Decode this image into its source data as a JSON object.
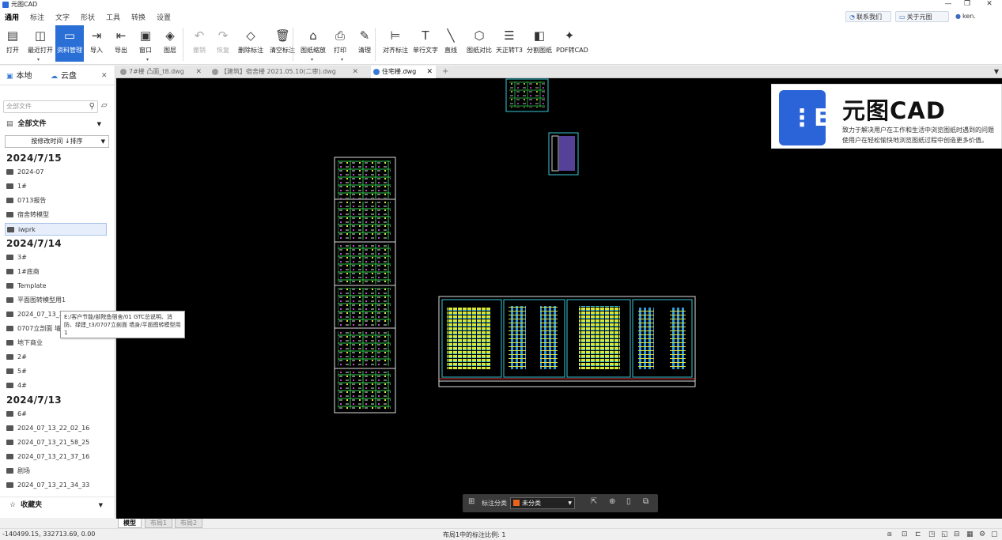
{
  "window": {
    "title": "元图CAD",
    "minimize": "—",
    "restore": "❐",
    "close": "✕"
  },
  "menu": [
    "通用",
    "标注",
    "文字",
    "形状",
    "工具",
    "转换",
    "设置"
  ],
  "top_links": {
    "contact": "联系我们",
    "about": "关于元图CAD",
    "user": "ken."
  },
  "ribbon": [
    {
      "label": "打开",
      "icon": "open-icon",
      "glyph": "▤"
    },
    {
      "label": "最近打开",
      "icon": "recent-icon",
      "glyph": "◫"
    },
    {
      "label": "资料管理",
      "icon": "library-icon",
      "glyph": "▭"
    },
    {
      "label": "导入",
      "icon": "import-icon",
      "glyph": "⇥"
    },
    {
      "label": "导出",
      "icon": "export-icon",
      "glyph": "⇤"
    },
    {
      "label": "窗口",
      "icon": "window-icon",
      "glyph": "▣"
    },
    {
      "label": "图层",
      "icon": "layers-icon",
      "glyph": "◈"
    },
    {
      "label": "撤销",
      "icon": "undo-icon",
      "glyph": "↶"
    },
    {
      "label": "恢复",
      "icon": "redo-icon",
      "glyph": "↷"
    },
    {
      "label": "删除标注",
      "icon": "eraser-icon",
      "glyph": "◇"
    },
    {
      "label": "清空标注",
      "icon": "trash-icon",
      "glyph": "🗑"
    },
    {
      "label": "图纸缩放",
      "icon": "zoom-icon",
      "glyph": "⌂"
    },
    {
      "label": "打印",
      "icon": "print-icon",
      "glyph": "⎙"
    },
    {
      "label": "清理",
      "icon": "broom-icon",
      "glyph": "✎"
    },
    {
      "label": "对齐标注",
      "icon": "align-icon",
      "glyph": "⊨"
    },
    {
      "label": "单行文字",
      "icon": "text-icon",
      "glyph": "T"
    },
    {
      "label": "直线",
      "icon": "line-icon",
      "glyph": "╲"
    },
    {
      "label": "图纸对比",
      "icon": "compare-icon",
      "glyph": "⬡"
    },
    {
      "label": "天正转T3",
      "icon": "convert-icon",
      "glyph": "☰"
    },
    {
      "label": "分割图纸",
      "icon": "split-icon",
      "glyph": "◧"
    },
    {
      "label": "PDF转CAD",
      "icon": "pdf-icon",
      "glyph": "✦"
    }
  ],
  "left_panel": {
    "tab_local": "本地",
    "tab_cloud": "云盘",
    "search_placeholder": "全部文件",
    "all_files": "全部文件",
    "sort": "按修改时间 ↓排序",
    "groups": [
      {
        "date": "2024/7/15",
        "items": [
          "2024-07",
          "1#",
          "0713报告",
          "宿舍转模型",
          "iwprk"
        ]
      },
      {
        "date": "2024/7/14",
        "items": [
          "3#",
          "1#底商",
          "Template",
          "平面图转模型用1",
          "2024_07_13_21",
          "0707立剖面 墙身",
          "地下商业",
          "2#",
          "5#",
          "4#"
        ]
      },
      {
        "date": "2024/7/13",
        "items": [
          "6#",
          "2024_07_13_22_02_16",
          "2024_07_13_21_58_25",
          "2024_07_13_21_37_16",
          "剧场",
          "2024_07_13_21_34_33"
        ]
      }
    ],
    "favorites": "收藏夹",
    "tooltip": "E:/客户节能/部院鱼宿舍/01 GTC总说明、消防、绿建_t3/0707立剖面 墙身/平面图转模型用1"
  },
  "doc_tabs": [
    {
      "label": "7#楼 凸面_t8.dwg",
      "active": false
    },
    {
      "label": "【建筑】宿舍楼 2021.05.10(二审).dwg",
      "active": false
    },
    {
      "label": "住宅楼.dwg",
      "active": true
    }
  ],
  "ad": {
    "brand": "元图CAD",
    "line1": "致力于解决用户在工作和生活中浏览图纸时遇到的问题",
    "line2": "使用户在轻松愉快地浏览图纸过程中创造更多价值。"
  },
  "floatbar": {
    "label": "标注分类",
    "category": "未分类",
    "category_color": "#e8641b"
  },
  "layout_tabs": [
    "模型",
    "布局1",
    "布局2"
  ],
  "status": {
    "coords": "-140499.15, 332713.69, 0.00",
    "scale": "布局1中的标注比例: 1"
  }
}
